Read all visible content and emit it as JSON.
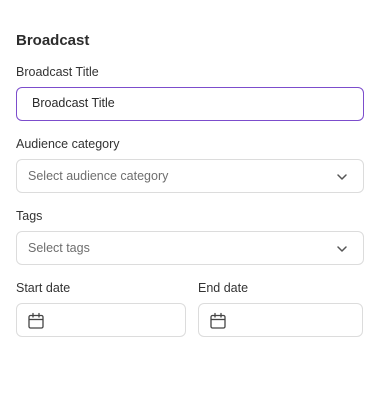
{
  "form": {
    "heading": "Broadcast",
    "title_label": "Broadcast Title",
    "title_value": "Broadcast Title",
    "audience_label": "Audience category",
    "audience_placeholder": "Select audience category",
    "tags_label": "Tags",
    "tags_placeholder": "Select tags",
    "start_label": "Start date",
    "end_label": "End date",
    "start_value": "",
    "end_value": ""
  },
  "colors": {
    "focus_border": "#7c4dcc",
    "border": "#dcdcdc",
    "placeholder": "#6e6e6e"
  },
  "icons": {
    "dropdown": "chevron-down-icon",
    "date": "calendar-icon"
  }
}
